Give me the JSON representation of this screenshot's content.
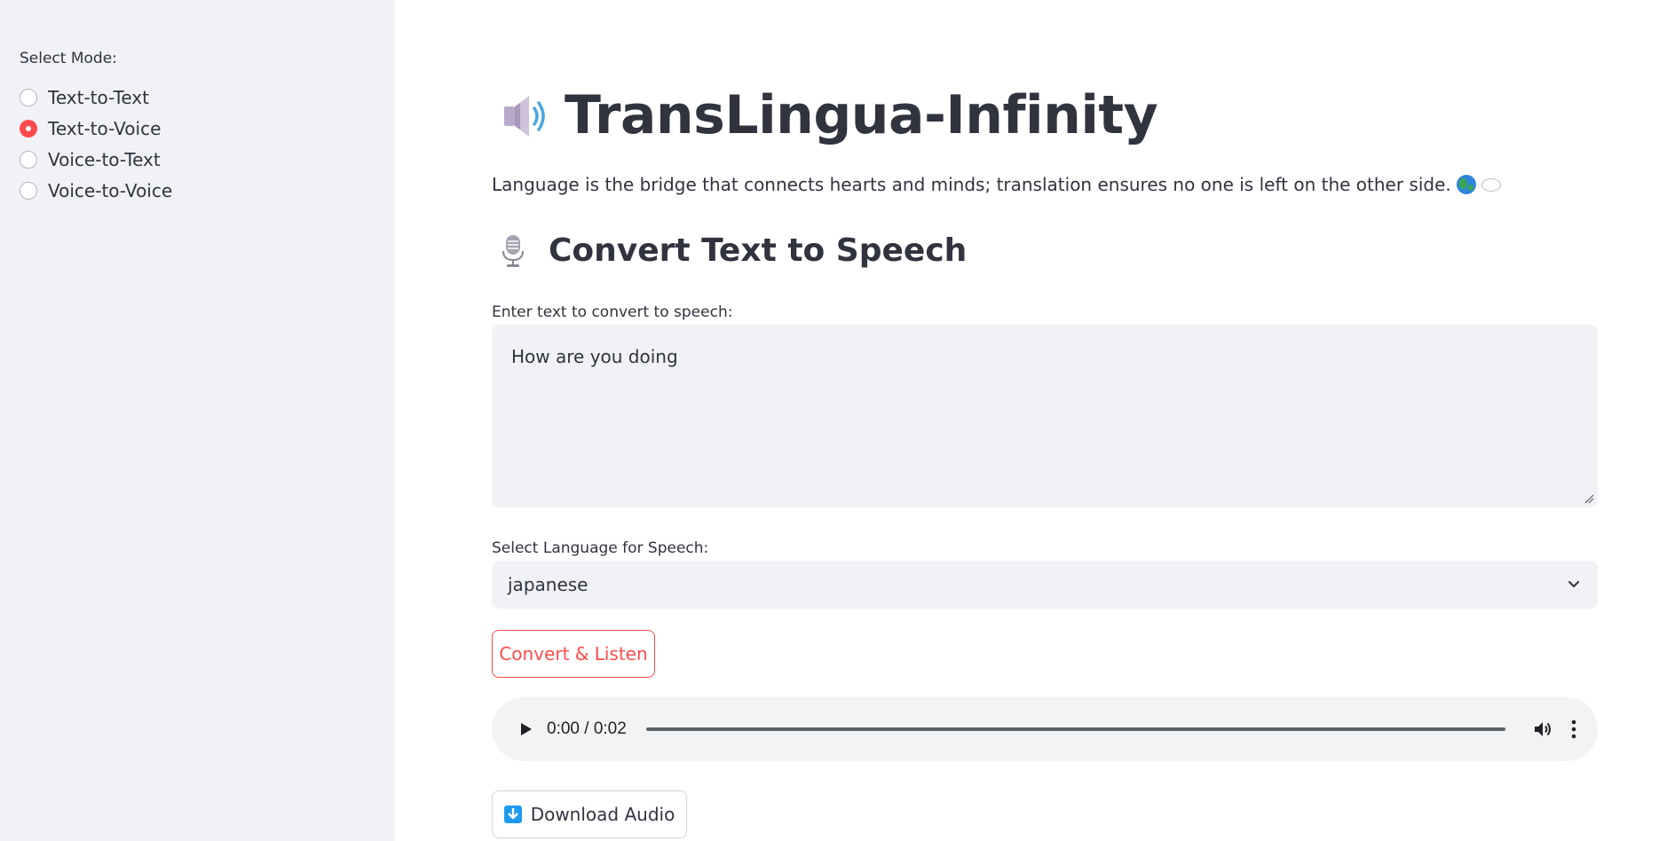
{
  "sidebar": {
    "label": "Select Mode:",
    "options": [
      {
        "label": "Text-to-Text",
        "selected": false
      },
      {
        "label": "Text-to-Voice",
        "selected": true
      },
      {
        "label": "Voice-to-Text",
        "selected": false
      },
      {
        "label": "Voice-to-Voice",
        "selected": false
      }
    ]
  },
  "header": {
    "icon": "speaker-icon",
    "title": "TransLingua-Infinity",
    "tagline": "Language is the bridge that connects hearts and minds; translation ensures no one is left on the other side.",
    "tagline_icons": [
      "globe-icon",
      "speech-bubble-icon"
    ]
  },
  "section": {
    "icon": "microphone-icon",
    "title": "Convert Text to Speech"
  },
  "text_input": {
    "label": "Enter text to convert to speech:",
    "value": "How are you doing"
  },
  "language_select": {
    "label": "Select Language for Speech:",
    "value": "japanese"
  },
  "convert_button": {
    "label": "Convert & Listen"
  },
  "audio": {
    "time": "0:00 / 0:02",
    "progress": 0
  },
  "download_button": {
    "icon": "download-arrow-icon",
    "label": "Download Audio"
  },
  "colors": {
    "accent": "#ff4b4b",
    "sidebar_bg": "#f0f2f6",
    "input_bg": "#f0f2f6",
    "text": "#31333f"
  }
}
